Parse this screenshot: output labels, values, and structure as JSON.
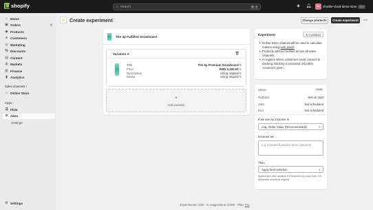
{
  "topbar": {
    "logo_text": "shopify",
    "search_placeholder": "Search",
    "shortcut_keys": [
      "⌘",
      "K"
    ],
    "store_initials": "cc",
    "store_name": "chuckle-cloud-demo-store",
    "store_badge": "Dev"
  },
  "sidebar": {
    "items": [
      {
        "label": "Home",
        "icon": "home-icon"
      },
      {
        "label": "Orders",
        "icon": "orders-icon",
        "count": "4"
      },
      {
        "label": "Products",
        "icon": "tag-icon"
      },
      {
        "label": "Customers",
        "icon": "person-icon"
      },
      {
        "label": "Marketing",
        "icon": "target-icon"
      },
      {
        "label": "Discounts",
        "icon": "discount-icon"
      },
      {
        "label": "Content",
        "icon": "content-icon"
      },
      {
        "label": "Markets",
        "icon": "globe-icon"
      },
      {
        "label": "Finance",
        "icon": "bank-icon"
      },
      {
        "label": "Analytics",
        "icon": "chart-icon"
      }
    ],
    "sales_channels_label": "Sales channels",
    "sales_channels": [
      {
        "label": "Online Store",
        "icon": "store-icon"
      }
    ],
    "apps_label": "Apps",
    "apps": [
      {
        "label": "Flow",
        "icon": "flow-icon"
      },
      {
        "label": "Abex",
        "icon": "abex-icon",
        "active": true
      },
      {
        "label": "Settings",
        "sub": true
      }
    ],
    "settings_label": "Settings"
  },
  "header": {
    "title": "Create experiment",
    "change_products_label": "Change products",
    "create_label": "Create experiment",
    "more_label": "⋯"
  },
  "experiment": {
    "product_name": "The 3p Fulfilled Snowboard",
    "variation_title": "Variation A",
    "fields": [
      {
        "label": "Title",
        "value": "The 6p Premium Snowboard"
      },
      {
        "label": "Price",
        "value": "RON 3,300.00"
      },
      {
        "label": "Description",
        "value": "Using original"
      },
      {
        "label": "Media",
        "value": "Using original"
      }
    ],
    "add_variation_label": "Add variation"
  },
  "experiment_info": {
    "title": "Experiment",
    "product_count_label": "1 product",
    "bullet1_before": "Online Store channel will be used to calculate metrics using ",
    "bullet1_link": "web pixels",
    "bullet1_after": ".",
    "bullet2": "Products will be modified across all sales channels.",
    "bullet3": "In regions where customers must consent to tracking, tracking is executed only after consent is given."
  },
  "status": {
    "status_label": "Status",
    "status_value": "Draft",
    "rollback_label": "Rollback",
    "rollback_value": "Sell on start",
    "start_label": "Start",
    "start_value": "Not scheduled",
    "end_label": "End",
    "end_value": "Not scheduled",
    "increase_label": "If we see an increase in",
    "metric_value": "Avg. Order Value (Recommended)",
    "because_label": "because we ...",
    "because_placeholder": "e.g. increased product price (optional)",
    "then_label": "Then",
    "then_value": "Apply best variation",
    "help_text": "Applies the best variation if it improves by more than 1%, otherwise reverts to original"
  },
  "footer": {
    "text": "Experiments: 1/50 · AI suggestions: 0/200 · Plan: ",
    "plan_link": "Pro"
  }
}
